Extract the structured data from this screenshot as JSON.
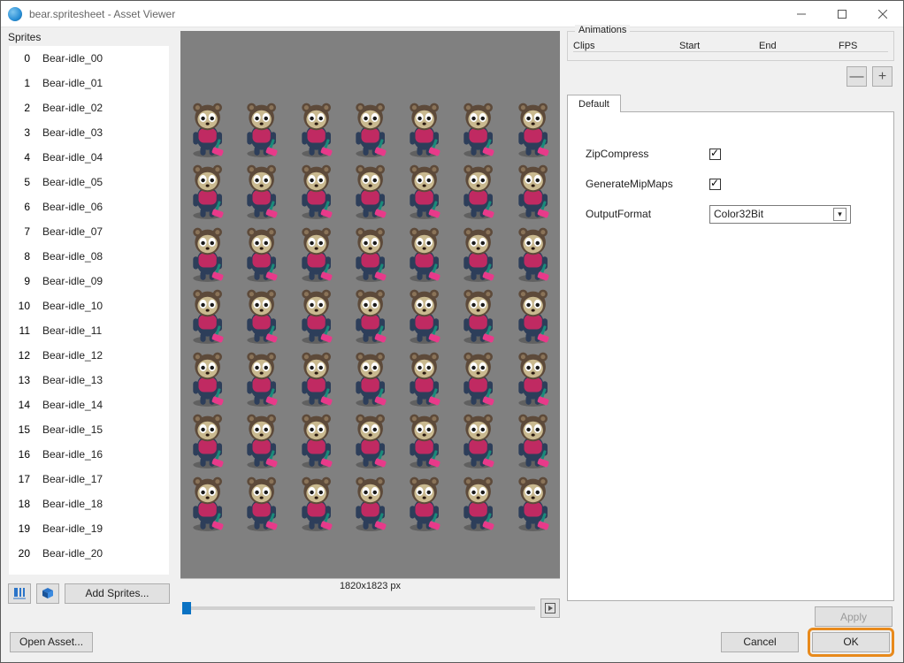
{
  "window": {
    "title": "bear.spritesheet - Asset Viewer"
  },
  "left": {
    "header": "Sprites",
    "add_sprites_label": "Add Sprites...",
    "items": [
      {
        "idx": "0",
        "name": "Bear-idle_00"
      },
      {
        "idx": "1",
        "name": "Bear-idle_01"
      },
      {
        "idx": "2",
        "name": "Bear-idle_02"
      },
      {
        "idx": "3",
        "name": "Bear-idle_03"
      },
      {
        "idx": "4",
        "name": "Bear-idle_04"
      },
      {
        "idx": "5",
        "name": "Bear-idle_05"
      },
      {
        "idx": "6",
        "name": "Bear-idle_06"
      },
      {
        "idx": "7",
        "name": "Bear-idle_07"
      },
      {
        "idx": "8",
        "name": "Bear-idle_08"
      },
      {
        "idx": "9",
        "name": "Bear-idle_09"
      },
      {
        "idx": "10",
        "name": "Bear-idle_10"
      },
      {
        "idx": "11",
        "name": "Bear-idle_11"
      },
      {
        "idx": "12",
        "name": "Bear-idle_12"
      },
      {
        "idx": "13",
        "name": "Bear-idle_13"
      },
      {
        "idx": "14",
        "name": "Bear-idle_14"
      },
      {
        "idx": "15",
        "name": "Bear-idle_15"
      },
      {
        "idx": "16",
        "name": "Bear-idle_16"
      },
      {
        "idx": "17",
        "name": "Bear-idle_17"
      },
      {
        "idx": "18",
        "name": "Bear-idle_18"
      },
      {
        "idx": "19",
        "name": "Bear-idle_19"
      },
      {
        "idx": "20",
        "name": "Bear-idle_20"
      }
    ]
  },
  "preview": {
    "dimensions": "1820x1823 px"
  },
  "animations": {
    "legend": "Animations",
    "cols": {
      "clips": "Clips",
      "start": "Start",
      "end": "End",
      "fps": "FPS"
    }
  },
  "tabs": {
    "default": "Default"
  },
  "settings": {
    "zip_label": "ZipCompress",
    "mip_label": "GenerateMipMaps",
    "out_label": "OutputFormat",
    "out_value": "Color32Bit"
  },
  "buttons": {
    "apply": "Apply",
    "cancel": "Cancel",
    "ok": "OK",
    "open_asset": "Open Asset...",
    "minus": "—",
    "plus": "+"
  }
}
